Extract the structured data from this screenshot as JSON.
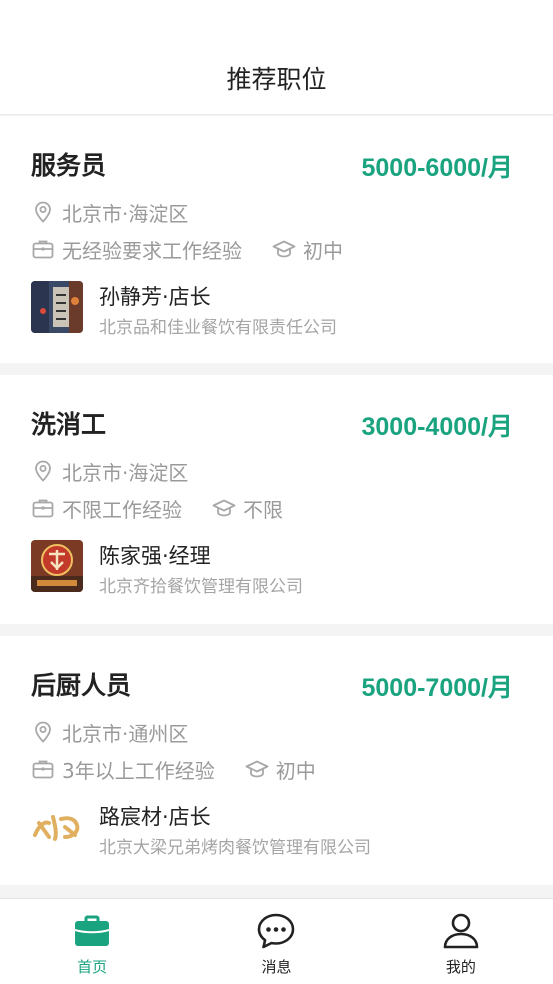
{
  "header": {
    "title": "推荐职位"
  },
  "colors": {
    "accent": "#1aa37f",
    "text": "#222222",
    "muted": "#9a9a9a"
  },
  "jobs": [
    {
      "title": "服务员",
      "salary": "5000-6000/月",
      "location": "北京市·海淀区",
      "experience": "无经验要求工作经验",
      "education": "初中",
      "recruiter": "孙静芳·店长",
      "company": "北京品和佳业餐饮有限责任公司"
    },
    {
      "title": "洗消工",
      "salary": "3000-4000/月",
      "location": "北京市·海淀区",
      "experience": "不限工作经验",
      "education": "不限",
      "recruiter": "陈家强·经理",
      "company": "北京齐拾餐饮管理有限公司"
    },
    {
      "title": "后厨人员",
      "salary": "5000-7000/月",
      "location": "北京市·通州区",
      "experience": "3年以上工作经验",
      "education": "初中",
      "recruiter": "路宸材·店长",
      "company": "北京大梁兄弟烤肉餐饮管理有限公司"
    }
  ],
  "tabbar": {
    "items": [
      {
        "label": "首页",
        "icon": "briefcase-icon",
        "active": true
      },
      {
        "label": "消息",
        "icon": "chat-bubble-icon",
        "active": false
      },
      {
        "label": "我的",
        "icon": "user-icon",
        "active": false
      }
    ]
  }
}
